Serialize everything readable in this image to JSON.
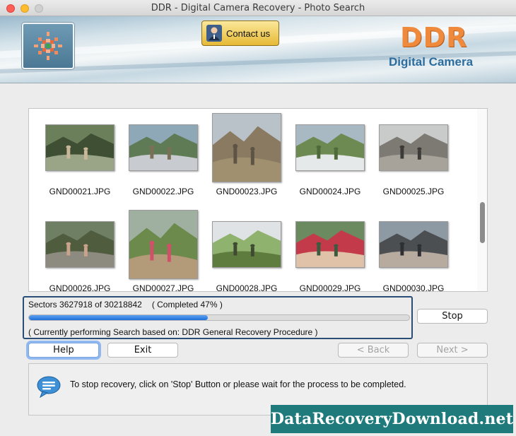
{
  "window": {
    "title": "DDR - Digital Camera Recovery - Photo Search"
  },
  "header": {
    "contact_label": "Contact us",
    "brand_name": "DDR",
    "brand_sub": "Digital Camera"
  },
  "gallery": {
    "items": [
      {
        "name": "GND00021.JPG",
        "selected": false
      },
      {
        "name": "GND00022.JPG",
        "selected": false
      },
      {
        "name": "GND00023.JPG",
        "selected": true
      },
      {
        "name": "GND00024.JPG",
        "selected": false
      },
      {
        "name": "GND00025.JPG",
        "selected": false
      },
      {
        "name": "GND00026.JPG",
        "selected": false
      },
      {
        "name": "GND00027.JPG",
        "selected": true
      },
      {
        "name": "GND00028.JPG",
        "selected": false
      },
      {
        "name": "GND00029.JPG",
        "selected": false
      },
      {
        "name": "GND00030.JPG",
        "selected": false
      }
    ]
  },
  "progress": {
    "sectors_text": "Sectors 3627918 of 30218842",
    "completed_text": "( Completed 47% )",
    "percent": 47,
    "status_text": "( Currently performing Search based on: DDR General Recovery Procedure )"
  },
  "buttons": {
    "stop": "Stop",
    "help": "Help",
    "exit": "Exit",
    "back": "< Back",
    "next": "Next >"
  },
  "info": {
    "message": "To stop recovery, click on 'Stop' Button or please wait for the process to be completed."
  },
  "watermark": "DataRecoveryDownload.net",
  "colors": {
    "accent": "#2a4e76",
    "progress_fill": "#1f6fd8",
    "brand_orange": "#ef8a3c",
    "brand_blue": "#2c6d9e",
    "watermark_bg": "#1f7a7c"
  },
  "icons": {
    "logo": "ddr-logo-icon",
    "contact": "person-icon",
    "info": "speech-bubble-icon"
  }
}
